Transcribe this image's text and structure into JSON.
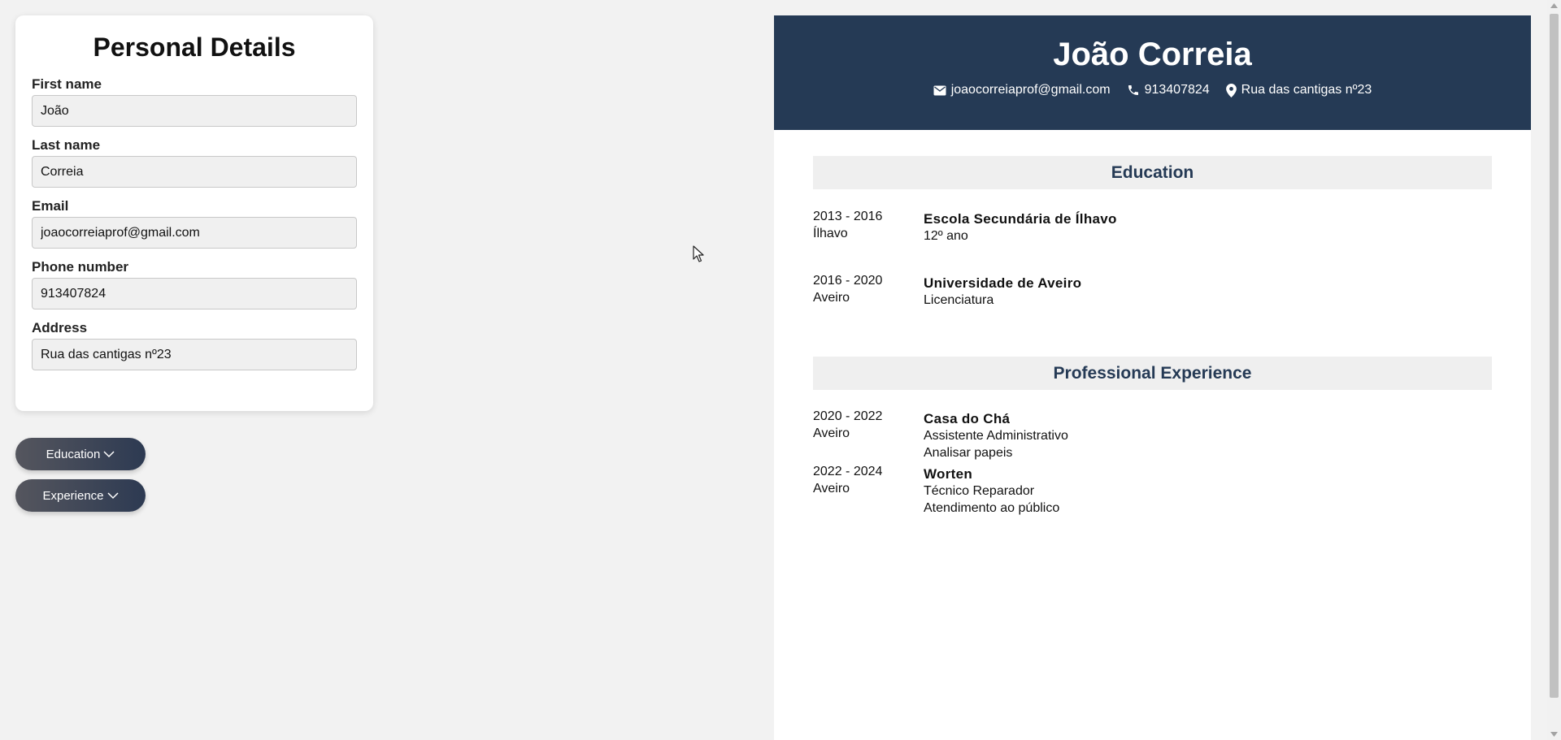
{
  "form": {
    "title": "Personal Details",
    "fields": [
      {
        "label": "First name",
        "value": "João"
      },
      {
        "label": "Last name",
        "value": "Correia"
      },
      {
        "label": "Email",
        "value": "joaocorreiaprof@gmail.com"
      },
      {
        "label": "Phone number",
        "value": "913407824"
      },
      {
        "label": "Address",
        "value": "Rua das cantigas nº23"
      }
    ]
  },
  "buttons": {
    "education": "Education",
    "experience": "Experience"
  },
  "resume": {
    "name": "João Correia",
    "email": "joaocorreiaprof@gmail.com",
    "phone": "913407824",
    "address": "Rua das cantigas nº23",
    "education": {
      "title": "Education",
      "entries": [
        {
          "years": "2013 - 2016",
          "location": "Ílhavo",
          "school": "Escola Secundária de Ílhavo",
          "degree": "12º ano"
        },
        {
          "years": "2016 - 2020",
          "location": "Aveiro",
          "school": "Universidade de Aveiro",
          "degree": "Licenciatura"
        }
      ]
    },
    "experience": {
      "title": "Professional Experience",
      "entries": [
        {
          "years": "2020 - 2022",
          "location": "Aveiro",
          "company": "Casa do Chá",
          "position": "Assistente Administrativo",
          "description": "Analisar papeis"
        },
        {
          "years": "2022 - 2024",
          "location": "Aveiro",
          "company": "Worten",
          "position": "Técnico Reparador",
          "description": "Atendimento ao público"
        }
      ]
    }
  },
  "colors": {
    "header_bg": "#253a55",
    "section_title": "#253a55",
    "page_bg": "#f2f2f2"
  },
  "icons": [
    "chevron-down-icon",
    "mail-icon",
    "phone-icon",
    "location-pin-icon",
    "mouse-cursor-icon"
  ]
}
